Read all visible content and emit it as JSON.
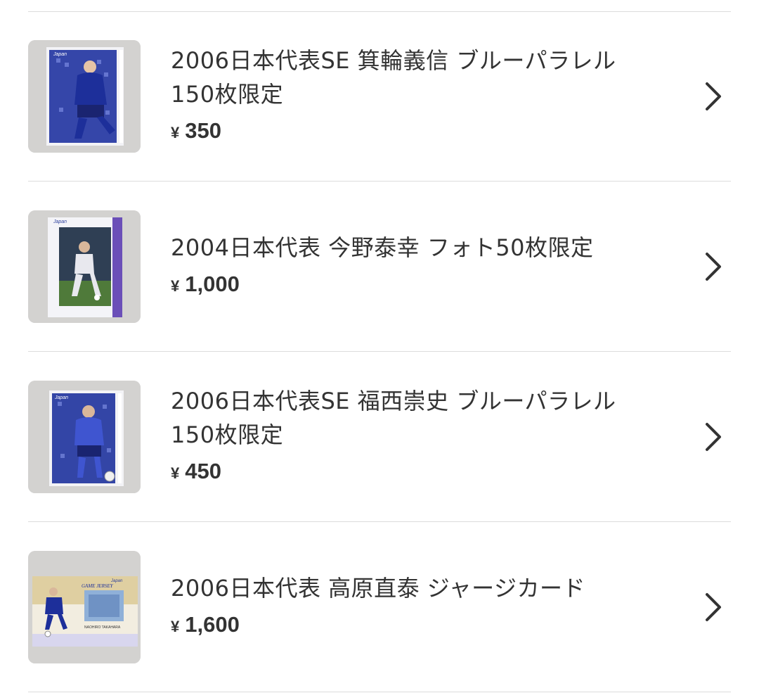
{
  "items": [
    {
      "title_lines": [
        "2006日本代表SE 箕輪義信 ブルーパラレル",
        "150枚限定"
      ],
      "currency": "¥",
      "price": "350",
      "thumbnail": "blue-parallel-card-photo",
      "card_logo": "Japan"
    },
    {
      "title_lines": [
        "2004日本代表 今野泰幸 フォト50枚限定"
      ],
      "currency": "¥",
      "price": "1,000",
      "thumbnail": "photo-card-photo",
      "card_logo": "Japan"
    },
    {
      "title_lines": [
        "2006日本代表SE 福西崇史 ブルーパラレル",
        "150枚限定"
      ],
      "currency": "¥",
      "price": "450",
      "thumbnail": "blue-parallel-card-photo",
      "card_logo": "Japan"
    },
    {
      "title_lines": [
        "2006日本代表 高原直泰 ジャージカード"
      ],
      "currency": "¥",
      "price": "1,600",
      "thumbnail": "jersey-card-photo",
      "card_logo": "Japan",
      "card_text": {
        "badge": "GAME JERSEY",
        "player": "NAOHIRO TAKAHARA"
      }
    }
  ],
  "icons": {
    "row_arrow": "chevron-right-icon"
  },
  "colors": {
    "text": "#333333",
    "divider": "#dcdcdc",
    "card_blue": "#2c3f9c"
  }
}
